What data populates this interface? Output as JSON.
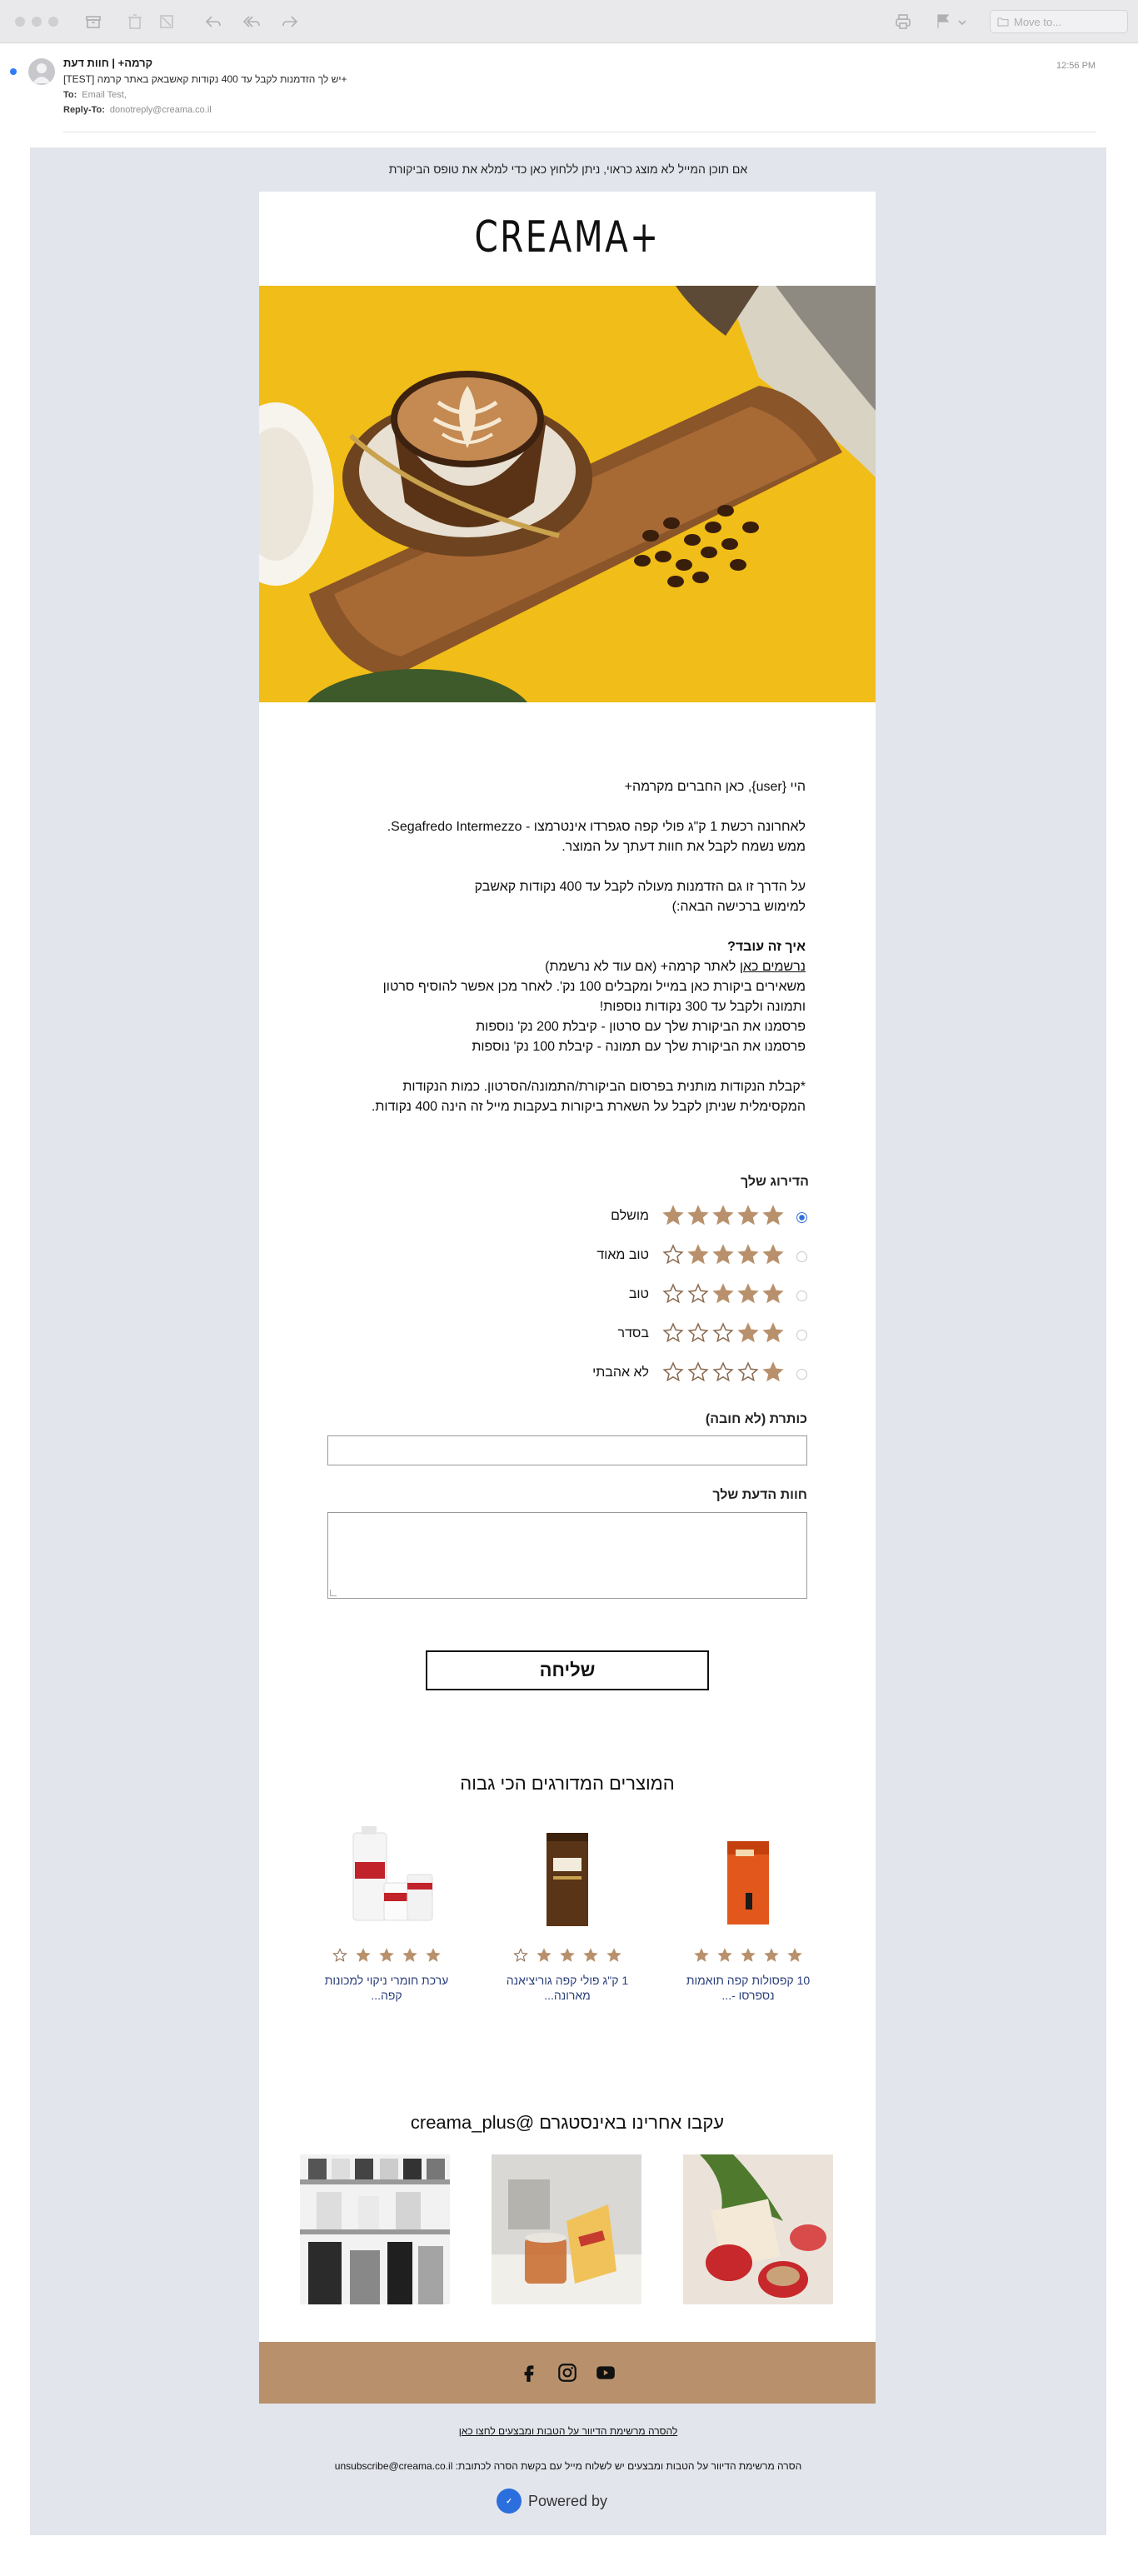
{
  "mail": {
    "move_to_placeholder": "Move to...",
    "from": "קרמה+ | חוות דעת",
    "subject": "[TEST] יש לך הזדמנות לקבל עד 400 נקודות קאשבאק באתר קרמה+",
    "to_label": "To:",
    "to_value": "Email Test,",
    "reply_to_label": "Reply-To:",
    "reply_to_value": "donotreply@creama.co.il",
    "time": "12:56 PM"
  },
  "email": {
    "preheader": "אם תוכן המייל לא מוצג כראוי, ניתן ללחוץ כאן כדי למלא את טופס הביקורת",
    "logo": "CREAMA+",
    "greeting": "היי {user}, כאן החברים מקרמה+",
    "intro_1": "לאחרונה רכשת 1 ק\"ג פולי קפה סגפרדו אינטרמצו - Segafredo Intermezzo.",
    "intro_2": "ממש נשמח לקבל את חוות דעתך על המוצר.",
    "promo_1": "על הדרך זו גם הזדמנות מעולה לקבל עד 400 נקודות קאשבק",
    "promo_2": "למימוש ברכישה הבאה:)",
    "how_title": "איך זה עובד?",
    "how_link": "נרשמים כאן",
    "how_1_rest": "לאתר קרמה+ (אם עוד לא נרשמת)",
    "how_2": "משאירים ביקורת כאן במייל ומקבלים 100 נק'. לאחר מכן אפשר להוסיף סרטון",
    "how_3": "ותמונה ולקבל עד 300 נקודות נוספות!",
    "how_4": "פרסמנו את הביקורת שלך עם סרטון - קיבלת 200 נק' נוספות",
    "how_5": "פרסמנו את הביקורת שלך עם תמונה - קיבלת 100 נק' נוספות",
    "note_1": "*קבלת הנקודות מותנית בפרסום הביקורת/התמונה/הסרטון. כמות הנקודות",
    "note_2": "המקסימלית שניתן לקבל על השארת ביקורות בעקבות מייל זה הינה 400 נקודות."
  },
  "rating": {
    "title": "הדירוג שלך",
    "selected": 5,
    "options": [
      {
        "stars": 5,
        "label": "מושלם"
      },
      {
        "stars": 4,
        "label": "טוב מאוד"
      },
      {
        "stars": 3,
        "label": "טוב"
      },
      {
        "stars": 2,
        "label": "בסדר"
      },
      {
        "stars": 1,
        "label": "לא אהבתי"
      }
    ],
    "star_color": "#b8916c"
  },
  "form": {
    "title_label": "כותרת (לא חובה)",
    "title_value": "",
    "review_label": "חוות הדעת שלך",
    "review_value": "",
    "submit_label": "שליחה"
  },
  "top_products": {
    "title": "המוצרים המדורגים הכי גבוה",
    "items": [
      {
        "name_line1": "10 קפסולות קפה תואמות",
        "name_line2": "נספרסו -...",
        "rating": 5
      },
      {
        "name_line1": "1 ק\"ג פולי קפה גוריציאנה",
        "name_line2": "מארונה...",
        "rating": 4
      },
      {
        "name_line1": "ערכת חומרי ניקוי למכונות",
        "name_line2": "קפה...",
        "rating": 4
      }
    ]
  },
  "instagram": {
    "title": "עקבו אחרינו באינסטגרם @creama_plus"
  },
  "footer": {
    "unsubscribe_text": "להסרה מרשימת הדיוור על הטבות ומבצעים לחצו כאן",
    "unsubscribe_email_text": "הסרה מרשימת הדיוור על הטבות ומבצעים יש לשלוח מייל עם בקשת הסרה לכתובת: unsubscribe@creama.co.il",
    "powered_by": "Powered by",
    "brand_bar_color": "#b8916c"
  }
}
